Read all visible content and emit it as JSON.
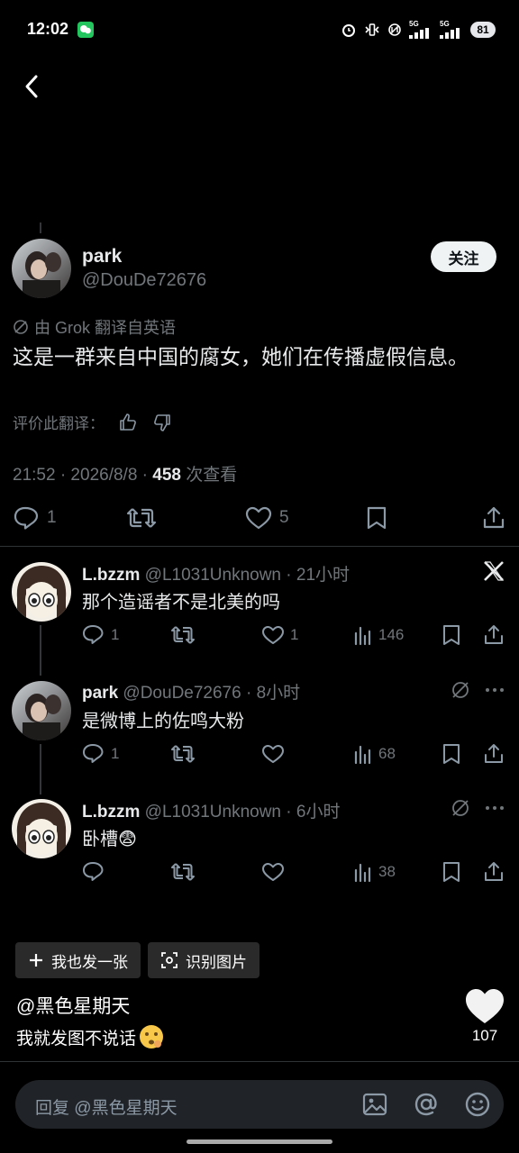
{
  "status_bar": {
    "time": "12:02",
    "signal_1": "5G",
    "signal_2": "5G",
    "battery": "81"
  },
  "main_tweet": {
    "name": "park",
    "handle": "@DouDe72676",
    "follow_label": "关注",
    "translated_note": "由 Grok 翻译自英语",
    "text": "这是一群来自中国的腐女，她们在传播虚假信息。",
    "rate_label": "评价此翻译：",
    "time_date": "21:52 · 2026/8/8 · ",
    "views": "458",
    "views_label": " 次查看",
    "reply_count": "1",
    "like_count": "5"
  },
  "replies": [
    {
      "name": "L.bzzm",
      "handle": "@L1031Unknown",
      "time": "· 21小时",
      "text": "那个造谣者不是北美的吗",
      "reply_count": "1",
      "like_count": "1",
      "views": "146"
    },
    {
      "name": "park",
      "handle": "@DouDe72676",
      "time": "· 8小时",
      "text": "是微博上的佐鸣大粉",
      "reply_count": "1",
      "like_count": "",
      "views": "68"
    },
    {
      "name": "L.bzzm",
      "handle": "@L1031Unknown",
      "time": "· 6小时",
      "text": "卧槽😨",
      "reply_count": "",
      "like_count": "",
      "views": "38"
    }
  ],
  "bottom_panel": {
    "chip_1": "我也发一张",
    "chip_2": "识别图片",
    "album_title": "@黑色星期天",
    "album_desc": "我就发图不说话",
    "like_count": "107"
  },
  "reply_bar": {
    "placeholder": "回复 @黑色星期天"
  },
  "colors": {
    "background": "#000000",
    "text_primary": "#e7e9ea",
    "text_muted": "#71767b",
    "divider": "#2f3336"
  }
}
